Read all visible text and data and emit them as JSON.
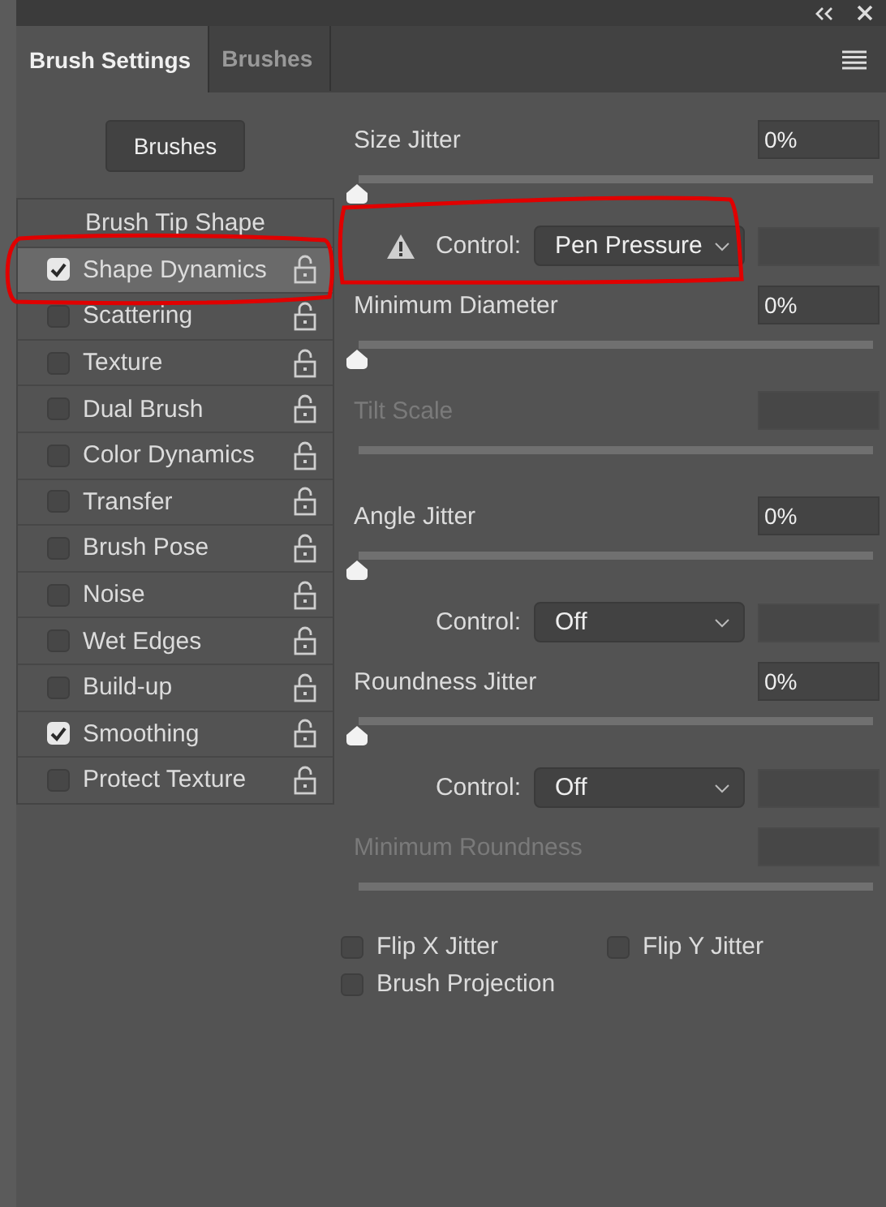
{
  "panel_tabs": [
    {
      "label": "Brush Settings",
      "selected": true
    },
    {
      "label": "Brushes",
      "selected": false
    }
  ],
  "brushes_button": "Brushes",
  "sections": [
    {
      "kind": "header",
      "label": "Brush Tip Shape",
      "selected": false
    },
    {
      "kind": "option",
      "label": "Shape Dynamics",
      "checked": true,
      "selected": true
    },
    {
      "kind": "option",
      "label": "Scattering",
      "checked": false,
      "selected": false
    },
    {
      "kind": "option",
      "label": "Texture",
      "checked": false,
      "selected": false
    },
    {
      "kind": "option",
      "label": "Dual Brush",
      "checked": false,
      "selected": false
    },
    {
      "kind": "option",
      "label": "Color Dynamics",
      "checked": false,
      "selected": false
    },
    {
      "kind": "option",
      "label": "Transfer",
      "checked": false,
      "selected": false
    },
    {
      "kind": "option",
      "label": "Brush Pose",
      "checked": false,
      "selected": false
    },
    {
      "kind": "option",
      "label": "Noise",
      "checked": false,
      "selected": false
    },
    {
      "kind": "option",
      "label": "Wet Edges",
      "checked": false,
      "selected": false
    },
    {
      "kind": "option",
      "label": "Build-up",
      "checked": false,
      "selected": false
    },
    {
      "kind": "option",
      "label": "Smoothing",
      "checked": true,
      "selected": false
    },
    {
      "kind": "option",
      "label": "Protect Texture",
      "checked": false,
      "selected": false
    }
  ],
  "settings": [
    {
      "kind": "slider",
      "label": "Size Jitter",
      "value": "0%",
      "level": 0,
      "disabled": false
    },
    {
      "kind": "control",
      "label": "Control:",
      "value": "Pen Pressure",
      "warning": true
    },
    {
      "kind": "slider",
      "label": "Minimum Diameter",
      "value": "0%",
      "level": 0,
      "disabled": false
    },
    {
      "kind": "slider",
      "label": "Tilt Scale",
      "disabled": true
    },
    {
      "kind": "slider",
      "label": "Angle Jitter",
      "value": "0%",
      "level": 0,
      "disabled": false
    },
    {
      "kind": "control",
      "label": "Control:",
      "value": "Off",
      "warning": false
    },
    {
      "kind": "slider",
      "label": "Roundness Jitter",
      "value": "0%",
      "level": 0,
      "disabled": false
    },
    {
      "kind": "control",
      "label": "Control:",
      "value": "Off",
      "warning": false
    },
    {
      "kind": "slider",
      "label": "Minimum Roundness",
      "disabled": true
    }
  ],
  "options": [
    {
      "label": "Flip X Jitter",
      "checked": false
    },
    {
      "label": "Flip Y Jitter",
      "checked": false
    },
    {
      "label": "Brush Projection",
      "checked": false
    }
  ]
}
